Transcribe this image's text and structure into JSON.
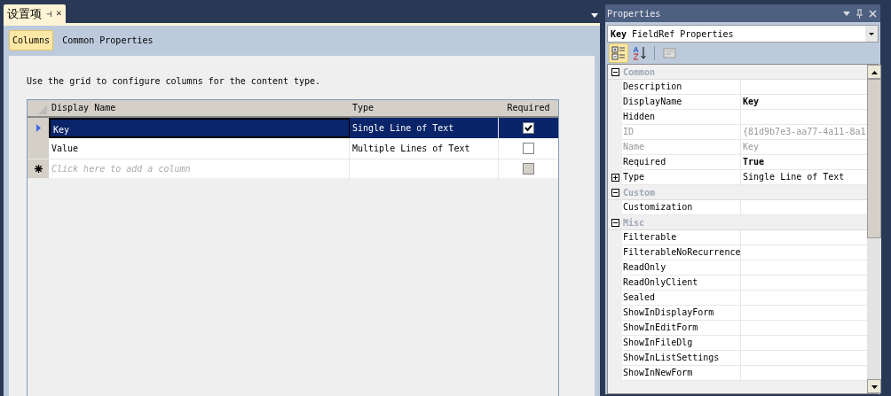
{
  "document_tab": {
    "title": "设置项",
    "pin": "⊣",
    "close": "✕"
  },
  "subtabs": [
    {
      "label": "Columns",
      "selected": true
    },
    {
      "label": "Common Properties",
      "selected": false
    }
  ],
  "instructions": "Use the grid to configure columns for the content type.",
  "grid": {
    "columns": [
      "Display Name",
      "Type",
      "Required"
    ],
    "rows": [
      {
        "name": "Key",
        "type": "Single Line of Text",
        "required": true,
        "selected": true
      },
      {
        "name": "Value",
        "type": "Multiple Lines of Text",
        "required": false,
        "selected": false
      }
    ],
    "new_row": {
      "placeholder": "Click here to add a column",
      "required": false,
      "disabled": true
    }
  },
  "properties": {
    "title": "Properties",
    "object": {
      "bold": "Key",
      "rest": "FieldRef Properties"
    },
    "toolbar": [
      {
        "kind": "categorized",
        "selected": true
      },
      {
        "kind": "alphabetical",
        "selected": false
      },
      {
        "kind": "pages",
        "selected": false
      }
    ],
    "rows": [
      {
        "kind": "category",
        "label": "Common",
        "expanded": true
      },
      {
        "kind": "property",
        "label": "Description",
        "value": "",
        "readonly": false
      },
      {
        "kind": "property",
        "label": "DisplayName",
        "value": "Key",
        "readonly": false,
        "modified": true
      },
      {
        "kind": "property",
        "label": "Hidden",
        "value": "",
        "readonly": false
      },
      {
        "kind": "property",
        "label": "ID",
        "value": "{81d9b7e3-aa77-4a11-8a1",
        "readonly": true,
        "modified": false
      },
      {
        "kind": "property",
        "label": "Name",
        "value": "Key",
        "readonly": true,
        "modified": false
      },
      {
        "kind": "property",
        "label": "Required",
        "value": "True",
        "readonly": false,
        "modified": true
      },
      {
        "kind": "property",
        "label": "Type",
        "value": "Single Line of Text",
        "readonly": false,
        "modified": false,
        "expanded": false
      },
      {
        "kind": "category",
        "label": "Custom",
        "expanded": true
      },
      {
        "kind": "property",
        "label": "Customization",
        "value": "",
        "readonly": false
      },
      {
        "kind": "category",
        "label": "Misc",
        "expanded": true
      },
      {
        "kind": "property",
        "label": "Filterable",
        "value": "",
        "readonly": false
      },
      {
        "kind": "property",
        "label": "FilterableNoRecurrence",
        "value": "",
        "readonly": false
      },
      {
        "kind": "property",
        "label": "ReadOnly",
        "value": "",
        "readonly": false
      },
      {
        "kind": "property",
        "label": "ReadOnlyClient",
        "value": "",
        "readonly": false
      },
      {
        "kind": "property",
        "label": "Sealed",
        "value": "",
        "readonly": false
      },
      {
        "kind": "property",
        "label": "ShowInDisplayForm",
        "value": "",
        "readonly": false
      },
      {
        "kind": "property",
        "label": "ShowInEditForm",
        "value": "",
        "readonly": false
      },
      {
        "kind": "property",
        "label": "ShowInFileDlg",
        "value": "",
        "readonly": false
      },
      {
        "kind": "property",
        "label": "ShowInListSettings",
        "value": "",
        "readonly": false
      },
      {
        "kind": "property",
        "label": "ShowInNewForm",
        "value": "",
        "readonly": false
      }
    ]
  }
}
